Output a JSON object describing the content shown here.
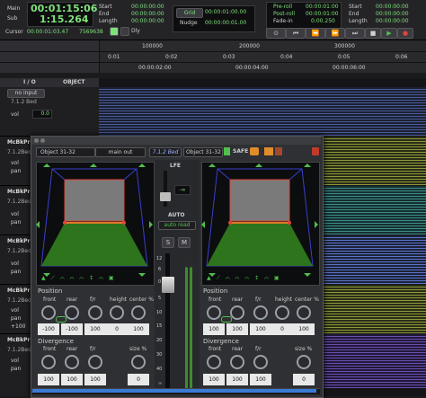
{
  "transport": {
    "main_label": "Main",
    "sub_label": "Sub",
    "main_value": "00:01:15:06",
    "sub_value": "1:15.264",
    "start_label": "Start",
    "end_label": "End",
    "length_label": "Length",
    "start_value": "00:00:00:00",
    "end_value": "00:00:00:00",
    "length_value": "00:00:00:00",
    "cursor_label": "Cursor",
    "cursor_value": "00:00:01:03.47",
    "sample_value": "7569638",
    "dly_label": "Dly",
    "grid_label": "Grid",
    "grid_value": "00:00:01:00.00",
    "nudge_label": "Nudge",
    "nudge_value": "00:00:00:01.00",
    "preroll_label": "Pre-roll",
    "postroll_label": "Post-roll",
    "fadein_label": "Fade-in",
    "preroll_value": "00:00:01:00",
    "postroll_value": "00:00:01:00",
    "fadein_value": "0:00.250",
    "r_start_label": "Start",
    "r_end_label": "End",
    "r_length_label": "Length",
    "r_start_value": "00:00:00:00",
    "r_end_value": "00:00:00:00",
    "r_length_value": "00:00:00:00"
  },
  "ruler": {
    "samples": [
      "100000",
      "200000",
      "300000"
    ],
    "bars": [
      "0:01",
      "0:02",
      "0:03",
      "0:04",
      "0:05",
      "0:06"
    ],
    "timecode": [
      "00:00:02:00",
      "00:00:04:00",
      "00:00:06:00"
    ]
  },
  "track_header": {
    "io_label": "I / O",
    "object_label": "OBJECT"
  },
  "tracks": [
    {
      "name": "",
      "input": "no input",
      "format": "7.1.2 Bed",
      "vol_label": "vol",
      "vol_value": "0.0"
    },
    {
      "name": "McBkPrM",
      "format": "7.1.2Bed",
      "vol_label": "vol",
      "pan_label": "pan"
    },
    {
      "name": "McBkPrM",
      "format": "7.1.2Bed",
      "vol_label": "vol",
      "pan_label": "pan"
    },
    {
      "name": "McBkPrM",
      "format": "7.1.2Bed",
      "vol_label": "vol",
      "pan_label": "pan"
    },
    {
      "name": "McBkPrM",
      "format": "7.1.2Bed",
      "vol_label": "vol",
      "pan_label": "pan",
      "pan_value": "+100"
    },
    {
      "name": "McBkPrM",
      "format": "7.1.2Bed",
      "vol_label": "vol",
      "pan_label": "pan"
    }
  ],
  "panner": {
    "object_left": "Object 31-32",
    "main_out": "main out",
    "bed": "7.1.2 Bed",
    "object_right": "Object 31-32",
    "safe_label": "SAFE",
    "lfe_label": "LFE",
    "lfe_value": "-∞",
    "auto_label": "AUTO",
    "auto_mode": "auto read",
    "solo_label": "S",
    "mute_label": "M",
    "fader_scale": [
      "12",
      "6",
      "0",
      "5",
      "10",
      "15",
      "20",
      "30",
      "40",
      "∞"
    ],
    "position_label": "Position",
    "divergence_label": "Divergence",
    "knob_labels": [
      "front",
      "rear",
      "f/r",
      "height",
      "center %"
    ],
    "div_labels": [
      "front",
      "rear",
      "f/r",
      "size %"
    ],
    "left_position_values": [
      "-100",
      "-100",
      "100",
      "0",
      "100"
    ],
    "left_div_values": [
      "100",
      "100",
      "100",
      "0"
    ],
    "right_position_values": [
      "100",
      "100",
      "100",
      "0",
      "100"
    ],
    "right_div_values": [
      "100",
      "100",
      "100",
      "0"
    ]
  },
  "colors": {
    "accent_green": "#4fc04b",
    "orange": "#e08c28",
    "wave_blue": "#5a74c8",
    "wave_olive": "#8e9a3a",
    "wave_teal": "#3b8e8c",
    "wave_purple": "#6a4fb0"
  }
}
